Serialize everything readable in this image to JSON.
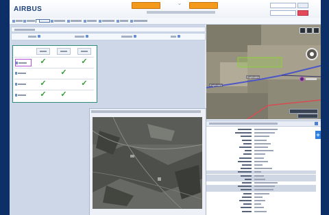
{
  "app": {
    "brand": "AIRBUS"
  },
  "header": {
    "caret_glyph": "⌄"
  },
  "matrix": {
    "checkmark_glyph": "✓",
    "rows": [
      {
        "selected": true,
        "checks": [
          true,
          false,
          true
        ]
      },
      {
        "selected": false,
        "checks": [
          false,
          true,
          false
        ]
      },
      {
        "selected": false,
        "checks": [
          true,
          false,
          true
        ]
      },
      {
        "selected": false,
        "checks": [
          true,
          true,
          false
        ]
      }
    ]
  },
  "map": {
    "road_label_left": "Euphrates",
    "road_label_mid": "Euphrates"
  },
  "properties": {
    "plus_glyph": "+"
  },
  "colors": {
    "accent_orange": "#f39a1c",
    "check_green": "#2e9a2e",
    "selection_purple": "#b24fd6",
    "matrix_border": "#2b8b7a",
    "route_line": "#4a55c8",
    "aoi_box": "#8ccf3a",
    "side_button": "#2f7fe0"
  }
}
